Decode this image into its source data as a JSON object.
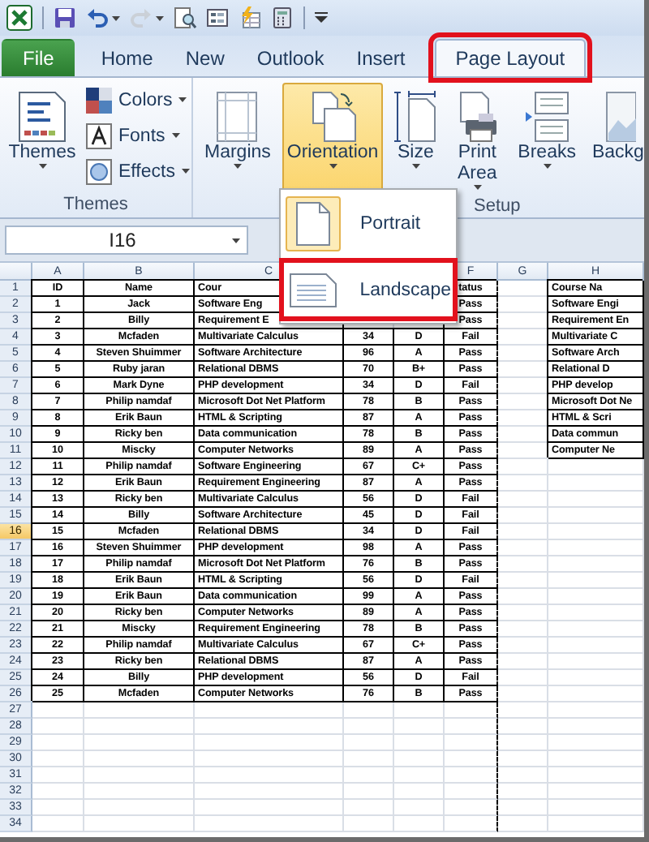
{
  "quick_access": [
    {
      "kind": "save",
      "disabled": false
    },
    {
      "kind": "undo",
      "disabled": false
    },
    {
      "kind": "redo",
      "disabled": true
    },
    {
      "kind": "preview",
      "disabled": false
    },
    {
      "kind": "form",
      "disabled": false
    },
    {
      "kind": "macro",
      "disabled": false
    },
    {
      "kind": "calculator",
      "disabled": false
    }
  ],
  "tabs": [
    {
      "label": "File",
      "kind": "file",
      "selected": false,
      "annotated": false
    },
    {
      "label": "Home",
      "kind": "tab",
      "selected": false,
      "annotated": false
    },
    {
      "label": "New",
      "kind": "tab",
      "selected": false,
      "annotated": false
    },
    {
      "label": "Outlook",
      "kind": "tab",
      "selected": false,
      "annotated": false
    },
    {
      "label": "Insert",
      "kind": "tab",
      "selected": false,
      "annotated": false
    },
    {
      "label": "Page Layout",
      "kind": "tab",
      "selected": true,
      "annotated": true
    }
  ],
  "themes_group": {
    "label": "Themes",
    "main_button": {
      "label": "Themes"
    },
    "small_buttons": [
      {
        "label": "Colors",
        "kind": "colors"
      },
      {
        "label": "Fonts",
        "kind": "fonts"
      },
      {
        "label": "Effects",
        "kind": "effects"
      }
    ]
  },
  "page_setup_group": {
    "label": "Setup",
    "buttons": [
      {
        "label": "Margins",
        "kind": "margins",
        "pressed": false,
        "dropdown": true
      },
      {
        "label": "Orientation",
        "kind": "orientation",
        "pressed": true,
        "dropdown": true
      },
      {
        "label": "Size",
        "kind": "size",
        "pressed": false,
        "dropdown": true
      },
      {
        "label": "Print Area",
        "kind": "print-area",
        "pressed": false,
        "dropdown": true
      },
      {
        "label": "Breaks",
        "kind": "breaks",
        "pressed": false,
        "dropdown": true
      },
      {
        "label": "Backg",
        "kind": "background",
        "pressed": false,
        "dropdown": false
      }
    ]
  },
  "name_box": {
    "value": "I16"
  },
  "orientation_menu": {
    "items": [
      {
        "label": "Portrait",
        "kind": "portrait",
        "selected": true,
        "annotated": false
      },
      {
        "label": "Landscape",
        "kind": "landscape",
        "selected": false,
        "annotated": true
      }
    ]
  },
  "sheet": {
    "columns": [
      {
        "label": "A",
        "page_break": false
      },
      {
        "label": "B",
        "page_break": false
      },
      {
        "label": "C",
        "page_break": false
      },
      {
        "page_break": false
      },
      {
        "page_break": false
      },
      {
        "label": "F",
        "page_break": true
      },
      {
        "label": "G",
        "page_break": false
      },
      {
        "label": "H",
        "page_break": false
      }
    ],
    "rows": [
      {
        "number": "1",
        "selected": false,
        "cells": [
          "ID",
          "Name",
          "Cour",
          null,
          null,
          "tatus",
          null,
          "Course Na"
        ]
      },
      {
        "number": "2",
        "selected": false,
        "cells": [
          "1",
          "Jack",
          "Software Eng",
          null,
          null,
          "Pass",
          null,
          "Software Engi"
        ]
      },
      {
        "number": "3",
        "selected": false,
        "cells": [
          "2",
          "Billy",
          "Requirement E",
          null,
          null,
          "Pass",
          null,
          "Requirement En"
        ]
      },
      {
        "number": "4",
        "selected": false,
        "cells": [
          "3",
          "Mcfaden",
          "Multivariate Calculus",
          "34",
          "D",
          "Fail",
          null,
          "Multivariate C"
        ]
      },
      {
        "number": "5",
        "selected": false,
        "cells": [
          "4",
          "Steven Shuimmer",
          "Software Architecture",
          "96",
          "A",
          "Pass",
          null,
          "Software Arch"
        ]
      },
      {
        "number": "6",
        "selected": false,
        "cells": [
          "5",
          "Ruby jaran",
          "Relational DBMS",
          "70",
          "B+",
          "Pass",
          null,
          "Relational D"
        ]
      },
      {
        "number": "7",
        "selected": false,
        "cells": [
          "6",
          "Mark Dyne",
          "PHP development",
          "34",
          "D",
          "Fail",
          null,
          "PHP develop"
        ]
      },
      {
        "number": "8",
        "selected": false,
        "cells": [
          "7",
          "Philip namdaf",
          "Microsoft Dot Net Platform",
          "78",
          "B",
          "Pass",
          null,
          "Microsoft Dot Ne"
        ]
      },
      {
        "number": "9",
        "selected": false,
        "cells": [
          "8",
          "Erik Baun",
          "HTML & Scripting",
          "87",
          "A",
          "Pass",
          null,
          "HTML & Scri"
        ]
      },
      {
        "number": "10",
        "selected": false,
        "cells": [
          "9",
          "Ricky ben",
          "Data communication",
          "78",
          "B",
          "Pass",
          null,
          "Data commun"
        ]
      },
      {
        "number": "11",
        "selected": false,
        "cells": [
          "10",
          "Miscky",
          "Computer Networks",
          "89",
          "A",
          "Pass",
          null,
          "Computer Ne"
        ]
      },
      {
        "number": "12",
        "selected": false,
        "cells": [
          "11",
          "Philip namdaf",
          "Software Engineering",
          "67",
          "C+",
          "Pass"
        ]
      },
      {
        "number": "13",
        "selected": false,
        "cells": [
          "12",
          "Erik Baun",
          "Requirement Engineering",
          "87",
          "A",
          "Pass"
        ]
      },
      {
        "number": "14",
        "selected": false,
        "cells": [
          "13",
          "Ricky ben",
          "Multivariate Calculus",
          "56",
          "D",
          "Fail"
        ]
      },
      {
        "number": "15",
        "selected": false,
        "cells": [
          "14",
          "Billy",
          "Software Architecture",
          "45",
          "D",
          "Fail"
        ]
      },
      {
        "number": "16",
        "selected": true,
        "cells": [
          "15",
          "Mcfaden",
          "Relational DBMS",
          "34",
          "D",
          "Fail"
        ]
      },
      {
        "number": "17",
        "selected": false,
        "cells": [
          "16",
          "Steven Shuimmer",
          "PHP development",
          "98",
          "A",
          "Pass"
        ]
      },
      {
        "number": "18",
        "selected": false,
        "cells": [
          "17",
          "Philip namdaf",
          "Microsoft Dot Net Platform",
          "76",
          "B",
          "Pass"
        ]
      },
      {
        "number": "19",
        "selected": false,
        "cells": [
          "18",
          "Erik Baun",
          "HTML & Scripting",
          "56",
          "D",
          "Fail"
        ]
      },
      {
        "number": "20",
        "selected": false,
        "cells": [
          "19",
          "Erik Baun",
          "Data communication",
          "99",
          "A",
          "Pass"
        ]
      },
      {
        "number": "21",
        "selected": false,
        "cells": [
          "20",
          "Ricky ben",
          "Computer Networks",
          "89",
          "A",
          "Pass"
        ]
      },
      {
        "number": "22",
        "selected": false,
        "cells": [
          "21",
          "Miscky",
          "Requirement Engineering",
          "78",
          "B",
          "Pass"
        ]
      },
      {
        "number": "23",
        "selected": false,
        "cells": [
          "22",
          "Philip namdaf",
          "Multivariate Calculus",
          "67",
          "C+",
          "Pass"
        ]
      },
      {
        "number": "24",
        "selected": false,
        "cells": [
          "23",
          "Ricky ben",
          "Relational DBMS",
          "87",
          "A",
          "Pass"
        ]
      },
      {
        "number": "25",
        "selected": false,
        "cells": [
          "24",
          "Billy",
          "PHP development",
          "56",
          "D",
          "Fail"
        ]
      },
      {
        "number": "26",
        "selected": false,
        "cells": [
          "25",
          "Mcfaden",
          "Computer Networks",
          "76",
          "B",
          "Pass"
        ]
      },
      {
        "number": "27",
        "selected": false
      },
      {
        "number": "28",
        "selected": false
      },
      {
        "number": "29",
        "selected": false
      },
      {
        "number": "30",
        "selected": false
      },
      {
        "number": "31",
        "selected": false
      },
      {
        "number": "32",
        "selected": false
      },
      {
        "number": "33",
        "selected": false
      },
      {
        "number": "34",
        "selected": false
      }
    ]
  }
}
